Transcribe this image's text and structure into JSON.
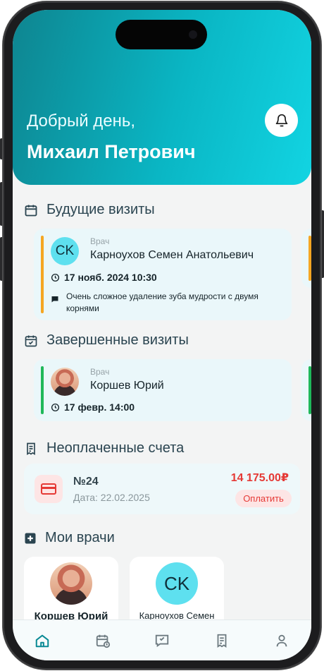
{
  "header": {
    "greeting": "Добрый день,",
    "user_name": "Михаил Петрович"
  },
  "upcoming": {
    "title": "Будущие визиты",
    "visit": {
      "role": "Врач",
      "initials": "CK",
      "doctor": "Карноухов Семен Анатольевич",
      "datetime": "17 нояб. 2024 10:30",
      "note": "Очень сложное удаление зуба мудрости с двумя корнями",
      "accent": "#f5a623"
    }
  },
  "completed": {
    "title": "Завершенные визиты",
    "visit": {
      "role": "Врач",
      "doctor": "Коршев Юрий",
      "datetime": "17 февр. 14:00",
      "accent": "#1fb85a"
    }
  },
  "invoices": {
    "title": "Неоплаченные счета",
    "item": {
      "number": "№24",
      "date": "Дата: 22.02.2025",
      "amount": "14 175.00₽",
      "pay_label": "Оплатить"
    }
  },
  "doctors": {
    "title": "Мои врачи",
    "items": [
      {
        "name": "Коршев Юрий"
      },
      {
        "name": "Карноухов Семен",
        "initials": "CK"
      }
    ]
  },
  "nav": {
    "items": [
      "home-icon",
      "calendar-icon",
      "chat-icon",
      "receipt-icon",
      "profile-icon"
    ],
    "active_color": "#0a8a95",
    "inactive_color": "#6d7a80"
  },
  "colors": {
    "brand": "#0ab6c4",
    "danger": "#e53935",
    "pay_bg": "#fde5e5"
  }
}
